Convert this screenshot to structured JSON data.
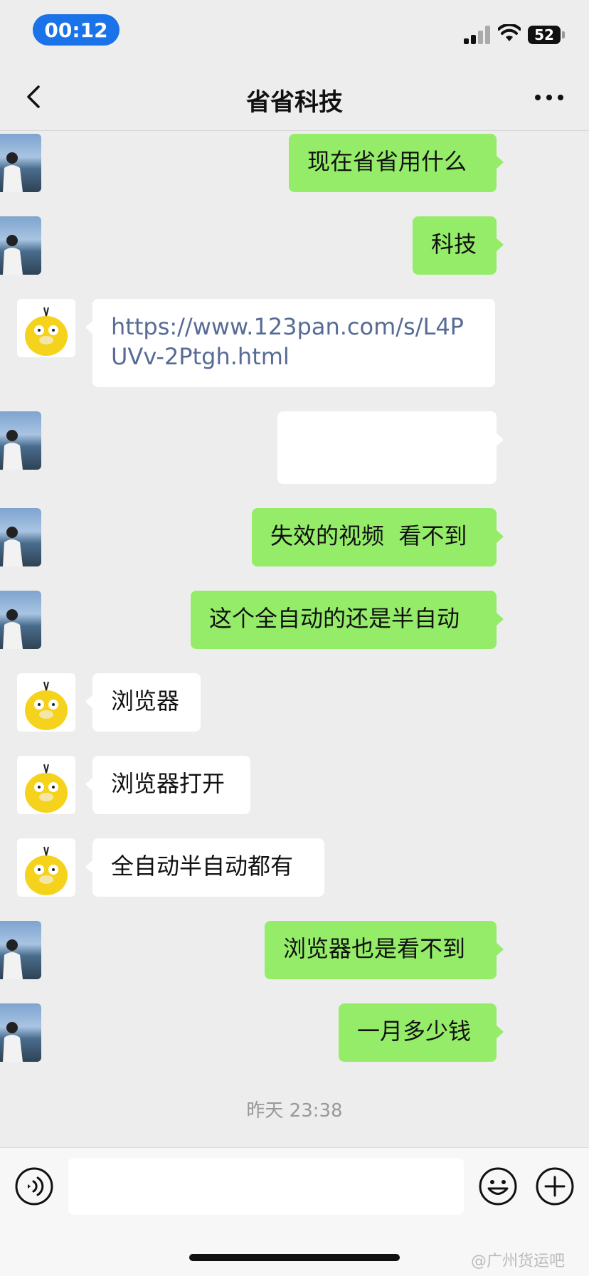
{
  "status_bar": {
    "time": "00:12",
    "battery": "52"
  },
  "nav": {
    "title": "省省科技"
  },
  "messages": [
    {
      "side": "me",
      "text": "现在省省用什么"
    },
    {
      "side": "me",
      "text": "科技"
    },
    {
      "side": "other",
      "text": "https://www.123pan.com/s/L4PUVv-2Ptgh.html"
    },
    {
      "side": "me",
      "text": ""
    },
    {
      "side": "me",
      "text": "失效的视频  看不到"
    },
    {
      "side": "me",
      "text": "这个全自动的还是半自动"
    },
    {
      "side": "other",
      "text": "浏览器"
    },
    {
      "side": "other",
      "text": "浏览器打开"
    },
    {
      "side": "other",
      "text": "全自动半自动都有"
    },
    {
      "side": "me",
      "text": "浏览器也是看不到"
    },
    {
      "side": "me",
      "text": "一月多少钱"
    }
  ],
  "timestamp": "昨天 23:38",
  "input": {
    "value": ""
  },
  "watermark": "@广州货运吧",
  "colors": {
    "my_bubble": "#95ec69",
    "other_bubble": "#ffffff",
    "link": "#576b95",
    "time_pill": "#1a73e8"
  }
}
